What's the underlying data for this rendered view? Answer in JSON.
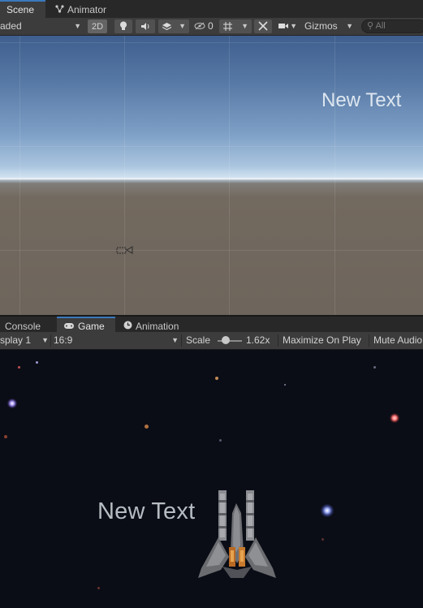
{
  "scene_tabs": {
    "scene_label": "Scene",
    "animator_label": "Animator",
    "animator_icon": "animator-icon"
  },
  "scene_toolbar": {
    "shading_mode": "aded",
    "mode_2d": "2D",
    "hidden_count": "0",
    "gizmos_label": "Gizmos",
    "search_placeholder": "All",
    "icons": [
      "lightbulb-icon",
      "speaker-icon",
      "layers-icon",
      "visibility-icon",
      "grid-icon",
      "tools-icon",
      "camera-icon",
      "search-icon"
    ]
  },
  "scene_view": {
    "text_object": "New Text"
  },
  "game_tabs": {
    "console_label": "Console",
    "game_label": "Game",
    "animation_label": "Animation",
    "game_icon": "gamepad-icon",
    "animation_icon": "clock-icon"
  },
  "game_toolbar": {
    "display": "splay 1",
    "aspect": "16:9",
    "scale_label": "Scale",
    "scale_value": "1.62x",
    "scale_fraction": 0.2,
    "maximize_label": "Maximize On Play",
    "mute_label": "Mute Audio"
  },
  "game_view": {
    "text_object": "New Text"
  },
  "colors": {
    "accent": "#3a79bb",
    "toolbar": "#3c3c3c",
    "tabbar": "#282828",
    "game_bg": "#0b0d16"
  }
}
